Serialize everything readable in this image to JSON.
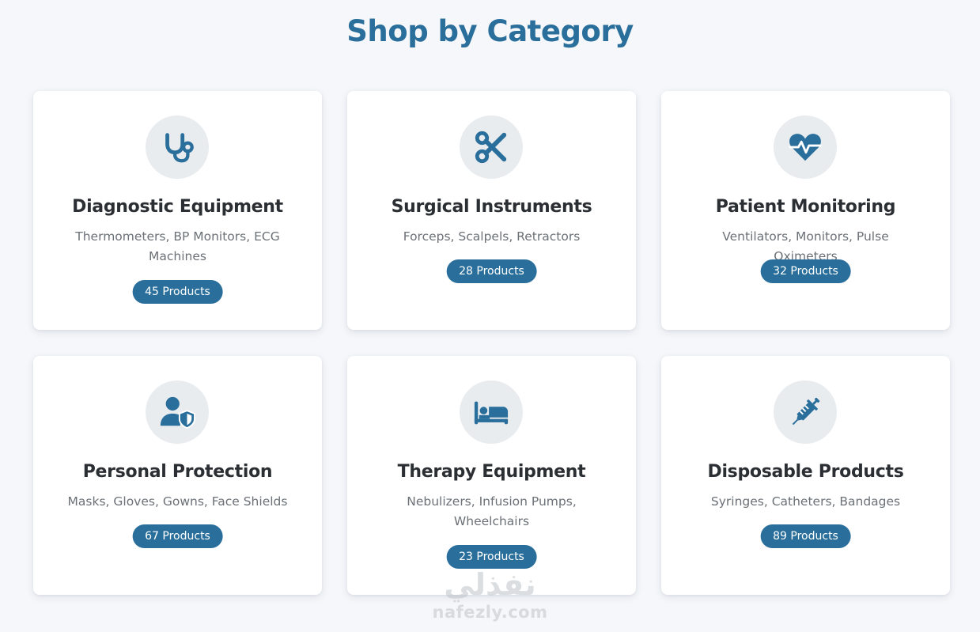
{
  "section_title": "Shop by Category",
  "accent_color": "#2a6f9b",
  "categories": [
    {
      "title": "Diagnostic Equipment",
      "description": "Thermometers, BP Monitors, ECG Machines",
      "count_label": "45 Products",
      "icon": "stethoscope-icon"
    },
    {
      "title": "Surgical Instruments",
      "description": "Forceps, Scalpels, Retractors",
      "count_label": "28 Products",
      "icon": "scissors-icon"
    },
    {
      "title": "Patient Monitoring",
      "description": "Ventilators, Monitors, Pulse Oximeters",
      "count_label": "32 Products",
      "icon": "heart-pulse-icon"
    },
    {
      "title": "Personal Protection",
      "description": "Masks, Gloves, Gowns, Face Shields",
      "count_label": "67 Products",
      "icon": "user-shield-icon"
    },
    {
      "title": "Therapy Equipment",
      "description": "Nebulizers, Infusion Pumps, Wheelchairs",
      "count_label": "23 Products",
      "icon": "bed-icon"
    },
    {
      "title": "Disposable Products",
      "description": "Syringes, Catheters, Bandages",
      "count_label": "89 Products",
      "icon": "syringe-icon"
    }
  ],
  "watermark": {
    "arabic": "نفذلي",
    "latin": "nafezly.com"
  }
}
